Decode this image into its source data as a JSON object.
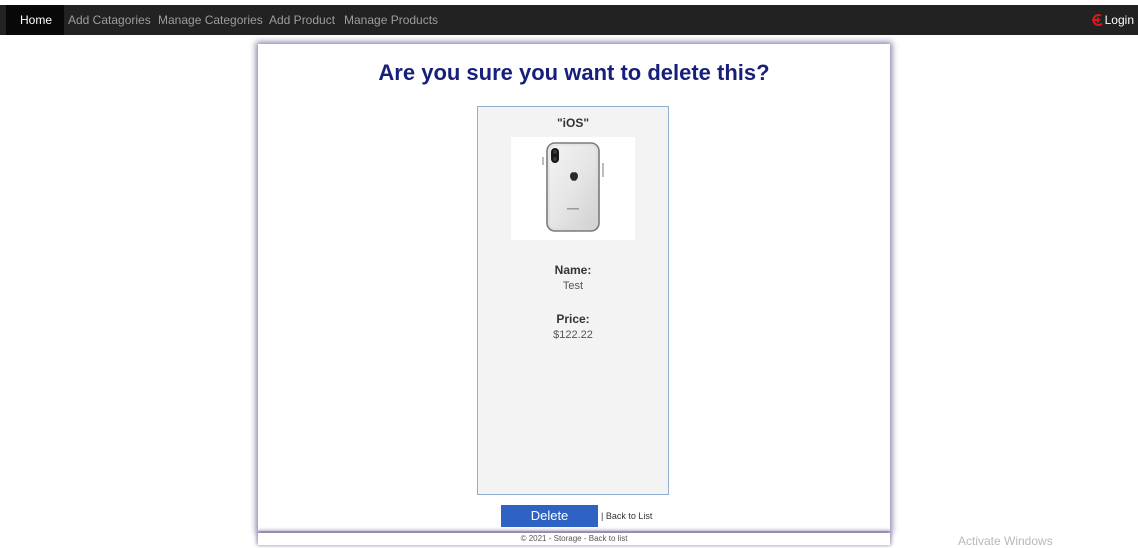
{
  "navbar": {
    "items": [
      {
        "label": "Home",
        "active": true
      },
      {
        "label": "Add Catagories",
        "active": false
      },
      {
        "label": "Manage Categories",
        "active": false
      },
      {
        "label": "Add Product",
        "active": false
      },
      {
        "label": "Manage Products",
        "active": false
      }
    ],
    "login_label": "Login",
    "login_icon": "login-icon",
    "colors": {
      "background": "#222222",
      "active_bg": "#080808",
      "login_icon": "#e0161b"
    }
  },
  "page": {
    "title": "Are you sure you want to delete this?",
    "title_color": "#171f7a"
  },
  "product": {
    "category": "\"iOS\"",
    "image": "iphone-back-image",
    "name_label": "Name:",
    "name_value": "Test",
    "price_label": "Price:",
    "price_value": "$122.22"
  },
  "actions": {
    "delete_label": "Delete",
    "back_label": "| Back to List",
    "delete_color": "#2e63c4"
  },
  "footer": {
    "text": "© 2021 - Storage - Back to list"
  },
  "watermark": {
    "text": "Activate Windows"
  }
}
